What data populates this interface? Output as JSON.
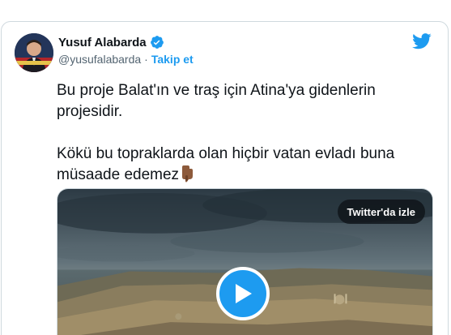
{
  "tweet": {
    "author_name": "Yusuf Alabarda",
    "handle": "@yusufalabarda",
    "separator": "·",
    "follow_label": "Takip et",
    "text": "Bu proje Balat'ın ve traş için Atina'ya gidenlerin projesidir.\n\nKökü bu topraklarda olan hiçbir vatan evladı buna müsaade edemez",
    "emoji": "backhand-index-pointing-down"
  },
  "media": {
    "watch_label": "Twitter'da izle"
  },
  "icons": {
    "verified": "verified-badge-icon",
    "brand": "twitter-bird-icon",
    "play": "play-icon"
  },
  "colors": {
    "accent": "#1d9bf0",
    "text": "#0f1419",
    "secondary": "#536471",
    "border": "#cfd9de"
  }
}
